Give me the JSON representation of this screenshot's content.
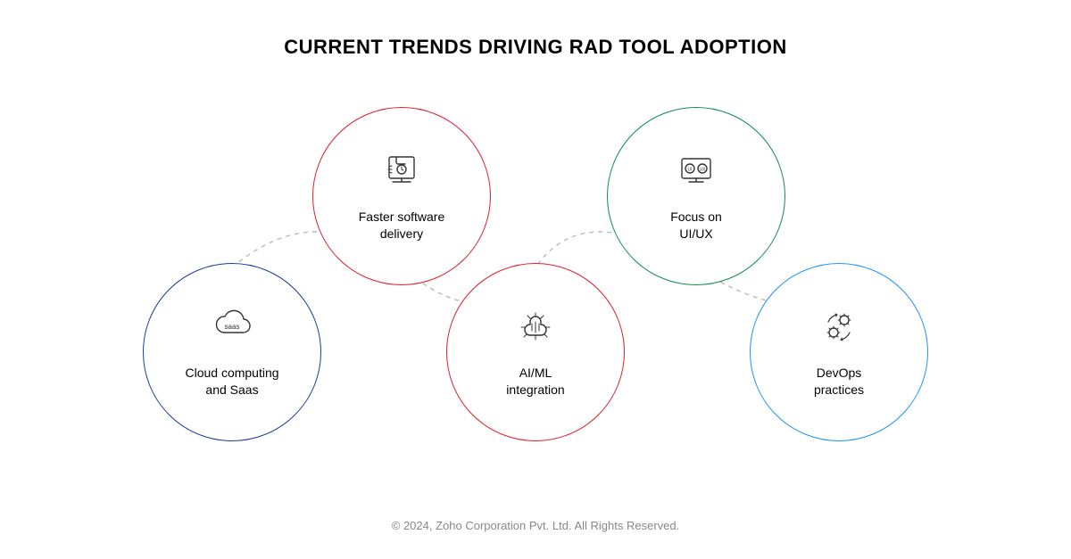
{
  "title": "CURRENT TRENDS DRIVING RAD TOOL ADOPTION",
  "circles": [
    {
      "label": "Cloud computing\nand Saas",
      "icon": "cloud-saas-icon",
      "color": "#1a3d9c"
    },
    {
      "label": "Faster software\ndelivery",
      "icon": "fast-delivery-icon",
      "color": "#e11d2a"
    },
    {
      "label": "AI/ML\nintegration",
      "icon": "ai-ml-icon",
      "color": "#e11d2a"
    },
    {
      "label": "Focus on\nUI/UX",
      "icon": "ui-ux-icon",
      "color": "#0a8f4a"
    },
    {
      "label": "DevOps\npractices",
      "icon": "devops-icon",
      "color": "#1e90ff"
    }
  ],
  "footer": "© 2024, Zoho Corporation Pvt. Ltd. All Rights Reserved."
}
